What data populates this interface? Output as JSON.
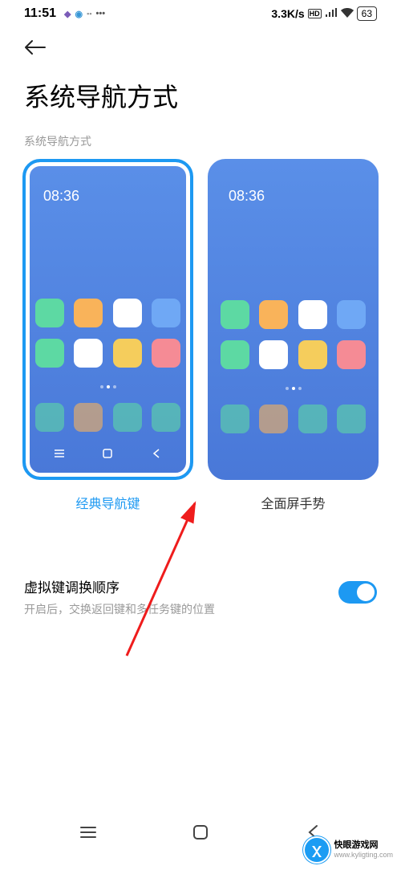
{
  "status": {
    "time": "11:51",
    "speed": "3.3K/s",
    "battery": "63"
  },
  "page": {
    "title": "系统导航方式",
    "section_label": "系统导航方式"
  },
  "options": {
    "mockup_time": "08:36",
    "classic_label": "经典导航键",
    "gesture_label": "全面屏手势"
  },
  "setting": {
    "title": "虚拟键调换顺序",
    "desc": "开启后，交换返回键和多任务键的位置"
  },
  "watermark": {
    "name": "快眼游戏网",
    "url": "www.kyligting.com"
  }
}
